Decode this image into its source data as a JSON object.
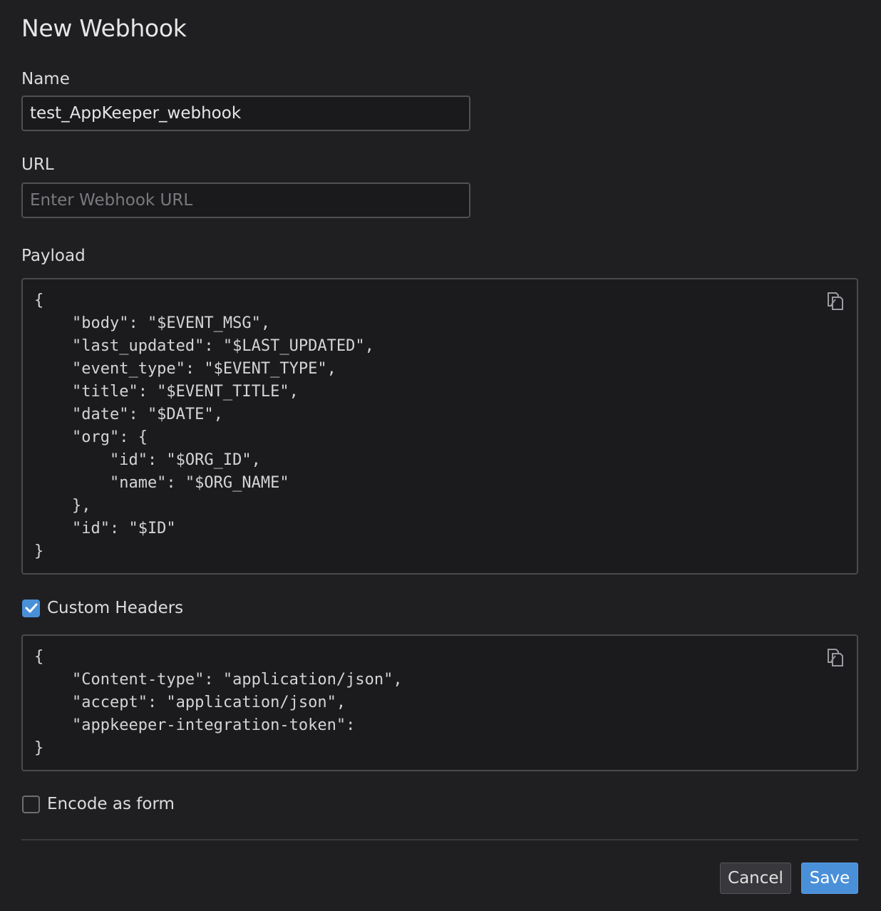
{
  "dialog": {
    "title": "New Webhook"
  },
  "name_field": {
    "label": "Name",
    "value": "test_AppKeeper_webhook"
  },
  "url_field": {
    "label": "URL",
    "value": "",
    "placeholder": "Enter Webhook URL"
  },
  "payload": {
    "label": "Payload",
    "code": "{\n    \"body\": \"$EVENT_MSG\",\n    \"last_updated\": \"$LAST_UPDATED\",\n    \"event_type\": \"$EVENT_TYPE\",\n    \"title\": \"$EVENT_TITLE\",\n    \"date\": \"$DATE\",\n    \"org\": {\n        \"id\": \"$ORG_ID\",\n        \"name\": \"$ORG_NAME\"\n    },\n    \"id\": \"$ID\"\n}",
    "copy_icon": "copy-icon"
  },
  "custom_headers": {
    "label": "Custom Headers",
    "checked": true,
    "code": "{\n    \"Content-type\": \"application/json\",\n    \"accept\": \"application/json\",\n    \"appkeeper-integration-token\":\n}",
    "copy_icon": "copy-icon"
  },
  "encode_as_form": {
    "label": "Encode as form",
    "checked": false
  },
  "footer": {
    "cancel_label": "Cancel",
    "save_label": "Save"
  },
  "colors": {
    "background": "#1f1f22",
    "accent": "#4a90d9",
    "border": "#505055"
  }
}
